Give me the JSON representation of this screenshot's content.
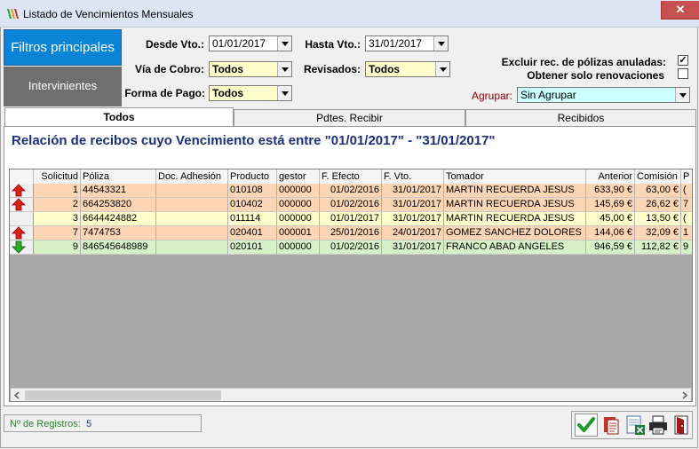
{
  "window": {
    "title": "Listado de Vencimientos Mensuales",
    "close_glyph": "✕"
  },
  "side_tabs": {
    "filtros": "Filtros principales",
    "intervinientes": "Intervinientes"
  },
  "filters": {
    "desde_label": "Desde Vto.:",
    "desde_value": "01/01/2017",
    "hasta_label": "Hasta Vto.:",
    "hasta_value": "31/01/2017",
    "via_label": "Vía de Cobro:",
    "via_value": "Todos",
    "revisados_label": "Revisados:",
    "revisados_value": "Todos",
    "forma_label": "Forma de Pago:",
    "forma_value": "Todos",
    "agrupar_label": "Agrupar:",
    "agrupar_value": "Sin Agrupar",
    "excluir_label": "Excluir rec. de pólizas anuladas:",
    "excluir_checked": true,
    "renovaciones_label": "Obtener solo renovaciones",
    "renovaciones_checked": false,
    "check_glyph": "✓"
  },
  "content_tabs": [
    "Todos",
    "Pdtes. Recibir",
    "Recibidos"
  ],
  "heading": "Relación de recibos cuyo Vencimiento está entre \"01/01/2017\" - \"31/01/2017\"",
  "table": {
    "columns": [
      "Solicitud",
      "Póliza",
      "Doc. Adhesión",
      "Producto",
      "gestor",
      "F. Efecto",
      "F. Vto.",
      "Tomador",
      "Anterior",
      "Comisión",
      "P"
    ],
    "rows": [
      {
        "indicator": "up",
        "color": "#fcd5b4",
        "cells": [
          "1",
          "44543321",
          "",
          "010108",
          "000000",
          "01/02/2016",
          "31/01/2017",
          "MARTIN RECUERDA JESUS",
          "633,90 €",
          "63,00 €",
          "("
        ]
      },
      {
        "indicator": "up",
        "color": "#fcd5b4",
        "cells": [
          "2",
          "664253820",
          "",
          "010402",
          "000000",
          "01/02/2016",
          "31/01/2017",
          "MARTIN RECUERDA JESUS",
          "145,69 €",
          "26,62 €",
          "7"
        ]
      },
      {
        "indicator": "none",
        "color": "#ffffcc",
        "cells": [
          "3",
          "6644424882",
          "",
          "011114",
          "000000",
          "01/01/2017",
          "31/01/2017",
          "MARTIN RECUERDA JESUS",
          "45,00 €",
          "13,50 €",
          "("
        ]
      },
      {
        "indicator": "up",
        "color": "#fcd5b4",
        "cells": [
          "7",
          "7474753",
          "",
          "020401",
          "000001",
          "25/01/2016",
          "24/01/2017",
          "GOMEZ SANCHEZ DOLORES",
          "144,06 €",
          "32,09 €",
          "1"
        ]
      },
      {
        "indicator": "down",
        "color": "#d8f0c8",
        "cells": [
          "9",
          "846545648989",
          "",
          "020101",
          "000000",
          "01/02/2016",
          "31/01/2017",
          "FRANCO ABAD ANGELES",
          "946,59 €",
          "112,82 €",
          "9"
        ]
      }
    ]
  },
  "status": {
    "label": "Nº de Registros:",
    "value": "5"
  },
  "colors": {
    "accent": "#0a84d6",
    "heading": "#1c2f7c",
    "row_orange": "#fcd5b4",
    "row_yellow": "#ffffcc",
    "row_green": "#d8f0c8"
  }
}
